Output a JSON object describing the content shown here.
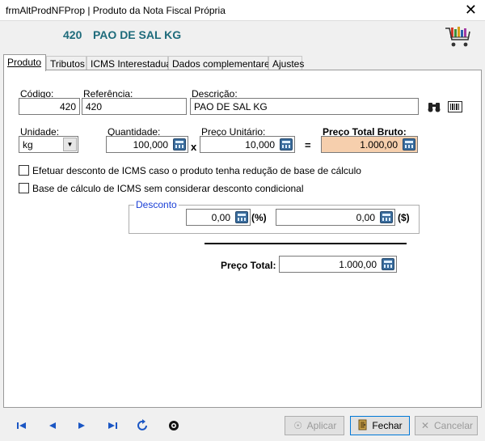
{
  "window": {
    "title": "frmAltProdNFProp | Produto da Nota Fiscal Própria",
    "close_glyph": "✕"
  },
  "header": {
    "code": "420",
    "name": "PAO DE SAL KG",
    "cart_icon": "shopping-cart-icon"
  },
  "tabs": [
    {
      "label": "Produto",
      "active": true
    },
    {
      "label": "Tributos"
    },
    {
      "label": "ICMS Interestadual"
    },
    {
      "label": "Dados complementares"
    },
    {
      "label": "Ajustes"
    }
  ],
  "product": {
    "codigo_label": "Código:",
    "codigo": "420",
    "referencia_label": "Referência:",
    "referencia": "420",
    "descricao_label": "Descrição:",
    "descricao": "PAO DE SAL KG",
    "binoculars_icon": "binoculars-icon",
    "barcode_icon": "barcode-icon",
    "unidade_label": "Unidade:",
    "unidade": "kg",
    "quantidade_label": "Quantidade:",
    "quantidade": "100,000",
    "times": "x",
    "preco_unitario_label": "Preço Unitário:",
    "preco_unitario": "10,000",
    "equals": "=",
    "preco_total_bruto_label": "Preço Total Bruto:",
    "preco_total_bruto": "1.000,00",
    "peach_color": "#f6cfad"
  },
  "options": {
    "desconto_icms": "Efetuar desconto de ICMS caso o produto tenha redução de base de cálculo",
    "base_calculo": "Base de cálculo de ICMS sem considerar desconto condicional"
  },
  "desconto": {
    "legend": "Desconto",
    "percent_value": "0,00",
    "percent_unit": "(%)",
    "value": "0,00",
    "value_unit": "($)"
  },
  "total": {
    "label": "Preço Total:",
    "value": "1.000,00"
  },
  "nav": [
    "first-icon",
    "previous-icon",
    "next-icon",
    "last-icon",
    "refresh-icon",
    "record-icon"
  ],
  "buttons": {
    "aplicar": "Aplicar",
    "fechar": "Fechar",
    "cancelar": "Cancelar"
  }
}
